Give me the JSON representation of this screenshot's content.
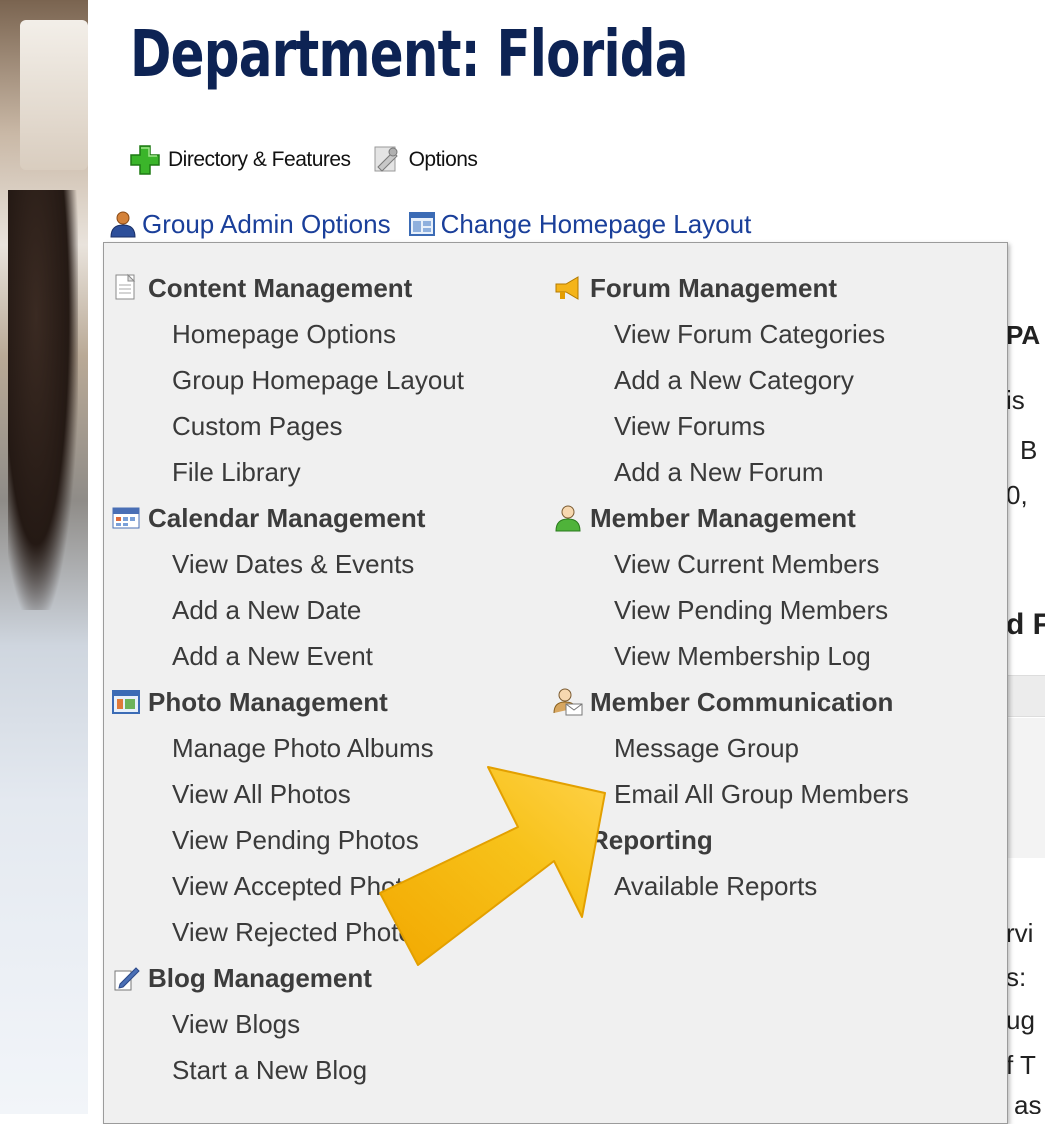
{
  "page": {
    "title": "Department: Florida"
  },
  "feature_bar": {
    "directory_label": "Directory & Features",
    "options_label": "Options"
  },
  "admin_bar": {
    "group_admin_label": "Group Admin Options",
    "change_layout_label": "Change Homepage Layout"
  },
  "background_fragments": [
    "PA",
    "is",
    "B",
    "0,",
    "d F",
    "rvi",
    "s:",
    "ug",
    "f T",
    "as"
  ],
  "menu": {
    "left": [
      {
        "heading": "Content Management",
        "icon": "document-icon",
        "items": [
          "Homepage Options",
          "Group Homepage Layout",
          "Custom Pages",
          "File Library"
        ]
      },
      {
        "heading": "Calendar Management",
        "icon": "calendar-icon",
        "items": [
          "View Dates & Events",
          "Add a New Date",
          "Add a New Event"
        ]
      },
      {
        "heading": "Photo Management",
        "icon": "photo-icon",
        "items": [
          "Manage Photo Albums",
          "View All Photos",
          "View Pending Photos",
          "View Accepted Photos",
          "View Rejected Photos"
        ]
      },
      {
        "heading": "Blog Management",
        "icon": "pencil-icon",
        "items": [
          "View Blogs",
          "Start a New Blog"
        ]
      }
    ],
    "right": [
      {
        "heading": "Forum Management",
        "icon": "megaphone-icon",
        "items": [
          "View Forum Categories",
          "Add a New Category",
          "View Forums",
          "Add a New Forum"
        ]
      },
      {
        "heading": "Member Management",
        "icon": "member-icon",
        "items": [
          "View Current Members",
          "View Pending Members",
          "View Membership Log"
        ]
      },
      {
        "heading": "Member Communication",
        "icon": "member-mail-icon",
        "items": [
          "Message Group",
          "Email All Group Members"
        ]
      },
      {
        "heading": "Reporting",
        "icon": "",
        "items": [
          "Available Reports"
        ]
      }
    ]
  },
  "colors": {
    "title": "#0d2354",
    "link": "#1a3f9a",
    "menu_bg": "#f0f0f0",
    "arrow": "#f6b400"
  }
}
